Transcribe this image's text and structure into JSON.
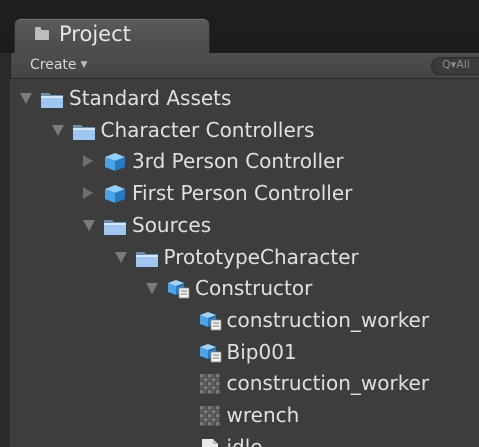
{
  "tab": {
    "label": "Project"
  },
  "toolbar": {
    "create_label": "Create",
    "search_text": "Q▾All"
  },
  "tree": [
    {
      "label": "Standard Assets",
      "expanded": true,
      "has_arrow": true,
      "icon": "folder-icon",
      "name": "tree-item-standard-assets"
    },
    {
      "label": "Character Controllers",
      "expanded": true,
      "has_arrow": true,
      "icon": "folder-icon",
      "name": "tree-item-character-controllers"
    },
    {
      "label": "3rd Person Controller",
      "expanded": false,
      "has_arrow": true,
      "icon": "prefab-icon",
      "name": "tree-item-3rd-person-controller"
    },
    {
      "label": "First Person Controller",
      "expanded": false,
      "has_arrow": true,
      "icon": "prefab-icon",
      "name": "tree-item-first-person-controller"
    },
    {
      "label": "Sources",
      "expanded": true,
      "has_arrow": true,
      "icon": "folder-icon",
      "name": "tree-item-sources"
    },
    {
      "label": "PrototypeCharacter",
      "expanded": true,
      "has_arrow": true,
      "icon": "folder-icon",
      "name": "tree-item-prototypecharacter"
    },
    {
      "label": "Constructor",
      "expanded": true,
      "has_arrow": true,
      "icon": "model-prefab-icon",
      "name": "tree-item-constructor"
    },
    {
      "label": "construction_worker",
      "expanded": false,
      "has_arrow": false,
      "icon": "mesh-icon",
      "name": "tree-item-construction-worker-mesh"
    },
    {
      "label": "Bip001",
      "expanded": false,
      "has_arrow": false,
      "icon": "mesh-icon",
      "name": "tree-item-bip001"
    },
    {
      "label": "construction_worker",
      "expanded": false,
      "has_arrow": false,
      "icon": "material-icon",
      "name": "tree-item-construction-worker-material"
    },
    {
      "label": "wrench",
      "expanded": false,
      "has_arrow": false,
      "icon": "material-icon",
      "name": "tree-item-wrench"
    },
    {
      "label": "idle",
      "expanded": false,
      "has_arrow": false,
      "icon": "animation-icon",
      "name": "tree-item-idle"
    }
  ],
  "colors": {
    "folder": "#9ec6ee",
    "prefab": "#4aa3e8",
    "text": "#e0e0e0"
  }
}
